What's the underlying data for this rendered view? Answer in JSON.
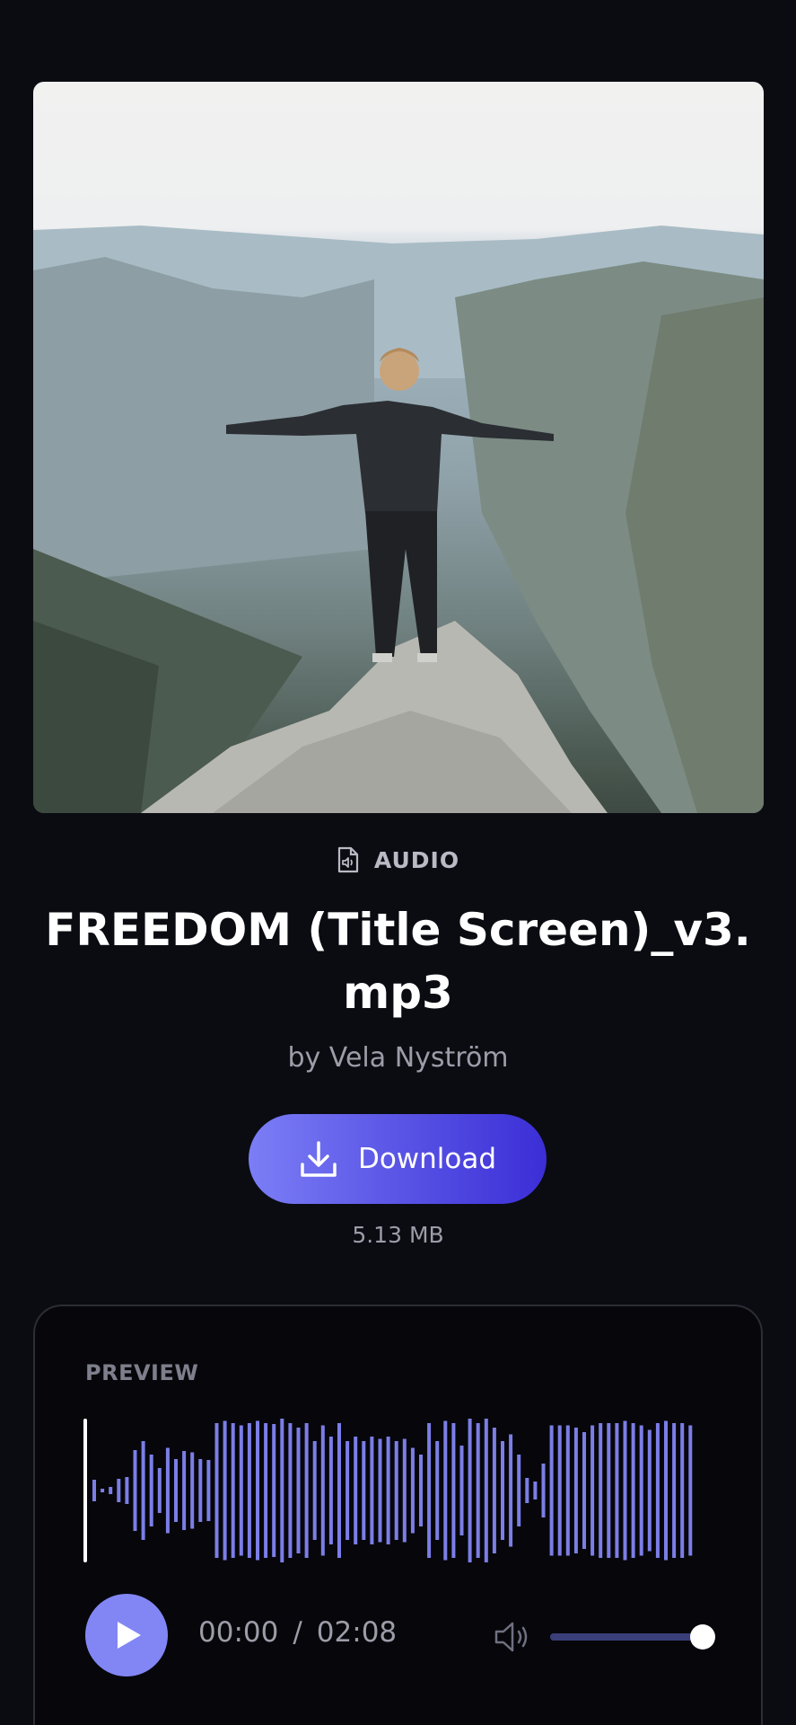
{
  "file": {
    "type_label": "AUDIO",
    "title": "FREEDOM (Title Screen)_v3.mp3",
    "artist": "by Vela Nyström",
    "size": "5.13 MB"
  },
  "actions": {
    "download_label": "Download"
  },
  "preview": {
    "label": "PREVIEW",
    "current_time": "00:00",
    "separator": "/",
    "duration": "02:08",
    "volume_level": 1.0,
    "playback_progress": 0.0
  },
  "colors": {
    "background": "#0b0c12",
    "accent": "#8286f4",
    "waveform": "#7b7ee6",
    "button_gradient_start": "#7b7ef6",
    "button_gradient_end": "#3b2ed6"
  },
  "icons": {
    "type_icon": "audio-file-icon",
    "download_icon": "download-icon",
    "play_icon": "play-icon",
    "volume_icon": "volume-icon"
  }
}
